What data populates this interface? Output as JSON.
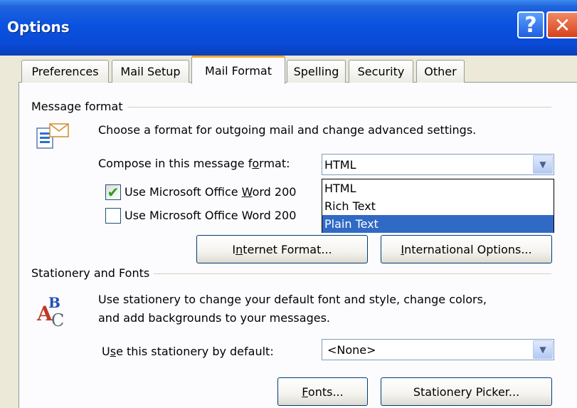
{
  "window": {
    "title": "Options",
    "help_glyph": "?",
    "close_glyph": "✕"
  },
  "tabs": [
    {
      "label": "Preferences"
    },
    {
      "label": "Mail Setup"
    },
    {
      "label": "Mail Format"
    },
    {
      "label": "Spelling"
    },
    {
      "label": "Security"
    },
    {
      "label": "Other"
    }
  ],
  "active_tab": "Mail Format",
  "message_format": {
    "group_label": "Message format",
    "description": "Choose a format for outgoing mail and change advanced settings.",
    "compose_label_pre": "Compose in this message f",
    "compose_label_accel": "o",
    "compose_label_post": "rmat:",
    "compose_value": "HTML",
    "compose_options": [
      "HTML",
      "Rich Text",
      "Plain Text"
    ],
    "highlighted_option": "Plain Text",
    "word_edit_pre": "Use Microsoft Office ",
    "word_edit_accel": "W",
    "word_edit_post": "ord 200",
    "word_edit_checked": true,
    "word_read_label": "Use Microsoft Office Word 200",
    "word_read_checked": false,
    "internet_format_pre": "I",
    "internet_format_accel": "n",
    "internet_format_post": "ternet Format...",
    "intl_options_accel": "I",
    "intl_options_post": "nternational Options..."
  },
  "stationery": {
    "group_label": "Stationery and Fonts",
    "description_line1": "Use stationery to change your default font and style, change colors,",
    "description_line2": "and add backgrounds to your messages.",
    "default_label_pre": "U",
    "default_label_accel": "s",
    "default_label_post": "e this stationery by default:",
    "default_value": "<None>",
    "fonts_accel": "F",
    "fonts_post": "onts...",
    "picker_label": "Stationery Picker..."
  },
  "icons": {
    "message_format_icon": "mail-document-icon",
    "stationery_icon": "fonts-abc-icon",
    "checkmark": "✔",
    "dropdown_arrow": "▼"
  },
  "colors": {
    "titlebar": "#0a52e0",
    "selection": "#316ac5",
    "active_tab_accent": "#f3a734",
    "close_button": "#d8411b"
  }
}
